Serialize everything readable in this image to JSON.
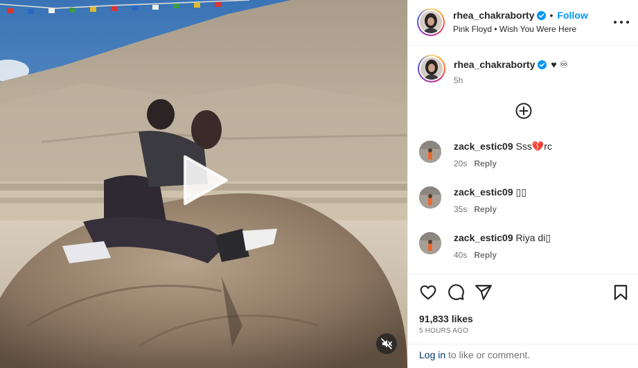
{
  "post": {
    "username": "rhea_chakraborty",
    "follow_label": "Follow",
    "separator": "•",
    "audio": "Pink Floyd • Wish You Were Here"
  },
  "caption": {
    "username": "rhea_chakraborty",
    "emojis": "♥ ♾",
    "time": "5h"
  },
  "comments": [
    {
      "username": "zack_estic09",
      "text": "Sss💔rc",
      "time": "20s",
      "reply": "Reply"
    },
    {
      "username": "zack_estic09",
      "text": "▯▯",
      "time": "35s",
      "reply": "Reply"
    },
    {
      "username": "zack_estic09",
      "text": "Riya di▯",
      "time": "40s",
      "reply": "Reply"
    }
  ],
  "stats": {
    "likes": "91,833 likes",
    "ago": "5 HOURS AGO"
  },
  "footer": {
    "login_link": "Log in",
    "login_rest": " to like or comment."
  },
  "colors": {
    "accent": "#0095f6",
    "link_dark": "#00376b",
    "muted": "#737373",
    "text": "#262626"
  },
  "icons": [
    "verified-badge-icon",
    "more-options-icon",
    "add-circle-icon",
    "heart-icon",
    "comment-icon",
    "share-icon",
    "bookmark-icon",
    "play-icon",
    "muted-speaker-icon"
  ]
}
